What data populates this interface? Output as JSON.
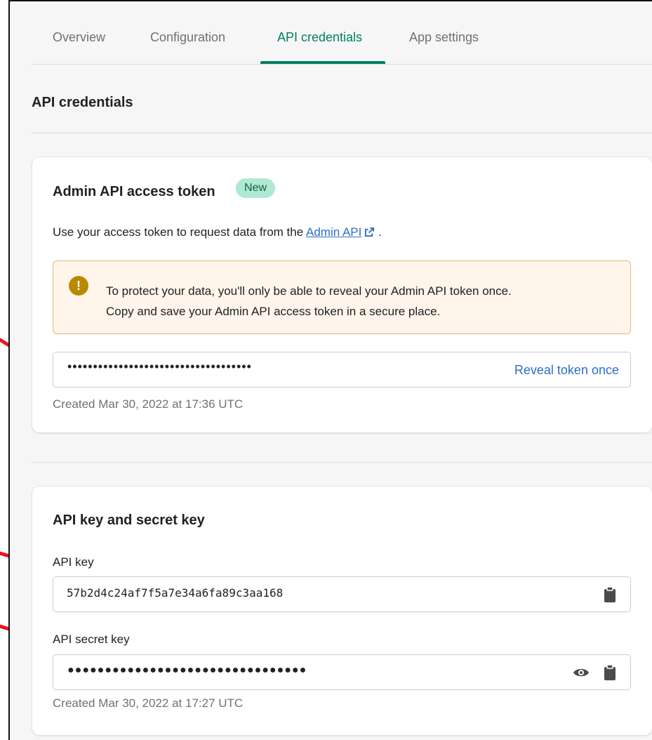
{
  "tabs": [
    {
      "label": "Overview",
      "active": false
    },
    {
      "label": "Configuration",
      "active": false
    },
    {
      "label": "API credentials",
      "active": true
    },
    {
      "label": "App settings",
      "active": false
    }
  ],
  "page_title": "API credentials",
  "token_card": {
    "title": "Admin API access token",
    "badge": "New",
    "desc_prefix": "Use your access token to request data from the",
    "desc_link": "Admin API",
    "desc_suffix": ".",
    "warning_line1": "To protect your data, you'll only be able to reveal your Admin API token once.",
    "warning_line2": "Copy and save your Admin API access token in a secure place.",
    "masked_token": "••••••••••••••••••••••••••••••••••••",
    "reveal_label": "Reveal token once",
    "created": "Created Mar 30, 2022 at 17:36 UTC"
  },
  "keys_card": {
    "title": "API key and secret key",
    "api_key_label": "API key",
    "api_key_value": "57b2d4c24af7f5a7e34a6fa89c3aa168",
    "secret_label": "API secret key",
    "secret_masked": "●●●●●●●●●●●●●●●●●●●●●●●●●●●●●●●●",
    "created": "Created Mar 30, 2022 at 17:27 UTC"
  },
  "icons": {
    "external_link": "external-link-icon",
    "warning": "exclamation-circle-icon",
    "clipboard": "clipboard-icon",
    "eye": "eye-icon",
    "annotation": "red-arrow-icon"
  },
  "colors": {
    "accent": "#008060",
    "link": "#2c6ecb",
    "badge_bg": "#aee9d1",
    "warning_bg": "#fff5ea",
    "warning_border": "#e1b878",
    "annotation_arrow": "#e8141c"
  }
}
